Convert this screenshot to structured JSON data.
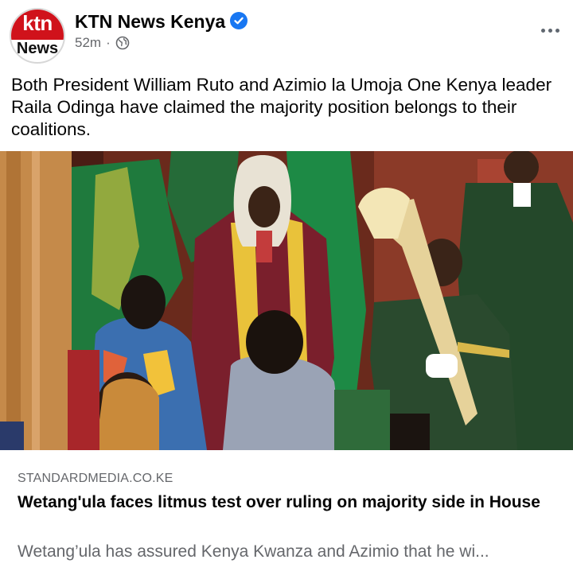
{
  "post": {
    "page_name": "KTN News Kenya",
    "avatar_top": "ktn",
    "avatar_bottom": "News",
    "time": "52m",
    "separator": "·",
    "audience_icon": "globe-icon",
    "verified_icon": "verified-badge-icon",
    "more_icon": "more-options-icon",
    "text": "Both President William Ruto and Azimio la Umoja One Kenya leader Raila Odinga have claimed the majority position belongs to their coalitions."
  },
  "link_preview": {
    "domain": "STANDARDMEDIA.CO.KE",
    "title": "Wetang'ula faces litmus test over ruling on majority side in House",
    "description": "Wetang’ula has assured Kenya Kwanza and Azimio that he wi..."
  },
  "colors": {
    "brand_red": "#d0121b",
    "verified_blue": "#1877f2",
    "secondary_text": "#65676b"
  }
}
